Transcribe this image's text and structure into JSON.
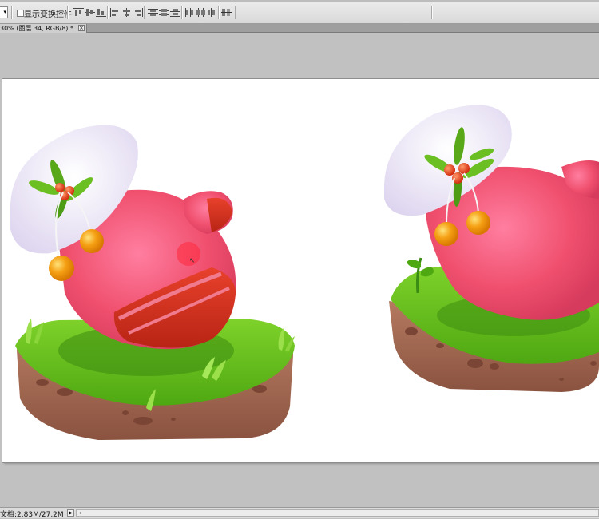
{
  "options_bar": {
    "tool_preset_arrow": "▾",
    "show_transform_controls_label": "显示变换控件",
    "show_transform_controls_checked": false
  },
  "document_tab": {
    "label": "30% (图层 34, RGB/8) *",
    "close_glyph": "×"
  },
  "status_bar": {
    "doc_info": "文档:2.83M/27.2M",
    "menu_arrow": "▶",
    "scroll_left_arrow": "◂"
  },
  "icons": {
    "align_group_1": [
      "align-top-edges-icon",
      "align-vertical-centers-icon",
      "align-bottom-edges-icon"
    ],
    "align_group_2": [
      "align-left-edges-icon",
      "align-horizontal-centers-icon",
      "align-right-edges-icon"
    ],
    "distribute_group_1": [
      "distribute-top-icon",
      "distribute-vcenter-icon",
      "distribute-bottom-icon"
    ],
    "distribute_group_2": [
      "distribute-left-icon",
      "distribute-hcenter-icon",
      "distribute-right-icon"
    ],
    "auto_align": "auto-align-layers-icon"
  },
  "colors": {
    "mitten_pink": "#f0506e",
    "mitten_red": "#c72a1e",
    "cuff_white": "#f1eef9",
    "grass_green": "#6cc21c",
    "soil_brown": "#a86e55",
    "berry_orange": "#f5a014",
    "brush_cursor": "#ff2a3c"
  }
}
